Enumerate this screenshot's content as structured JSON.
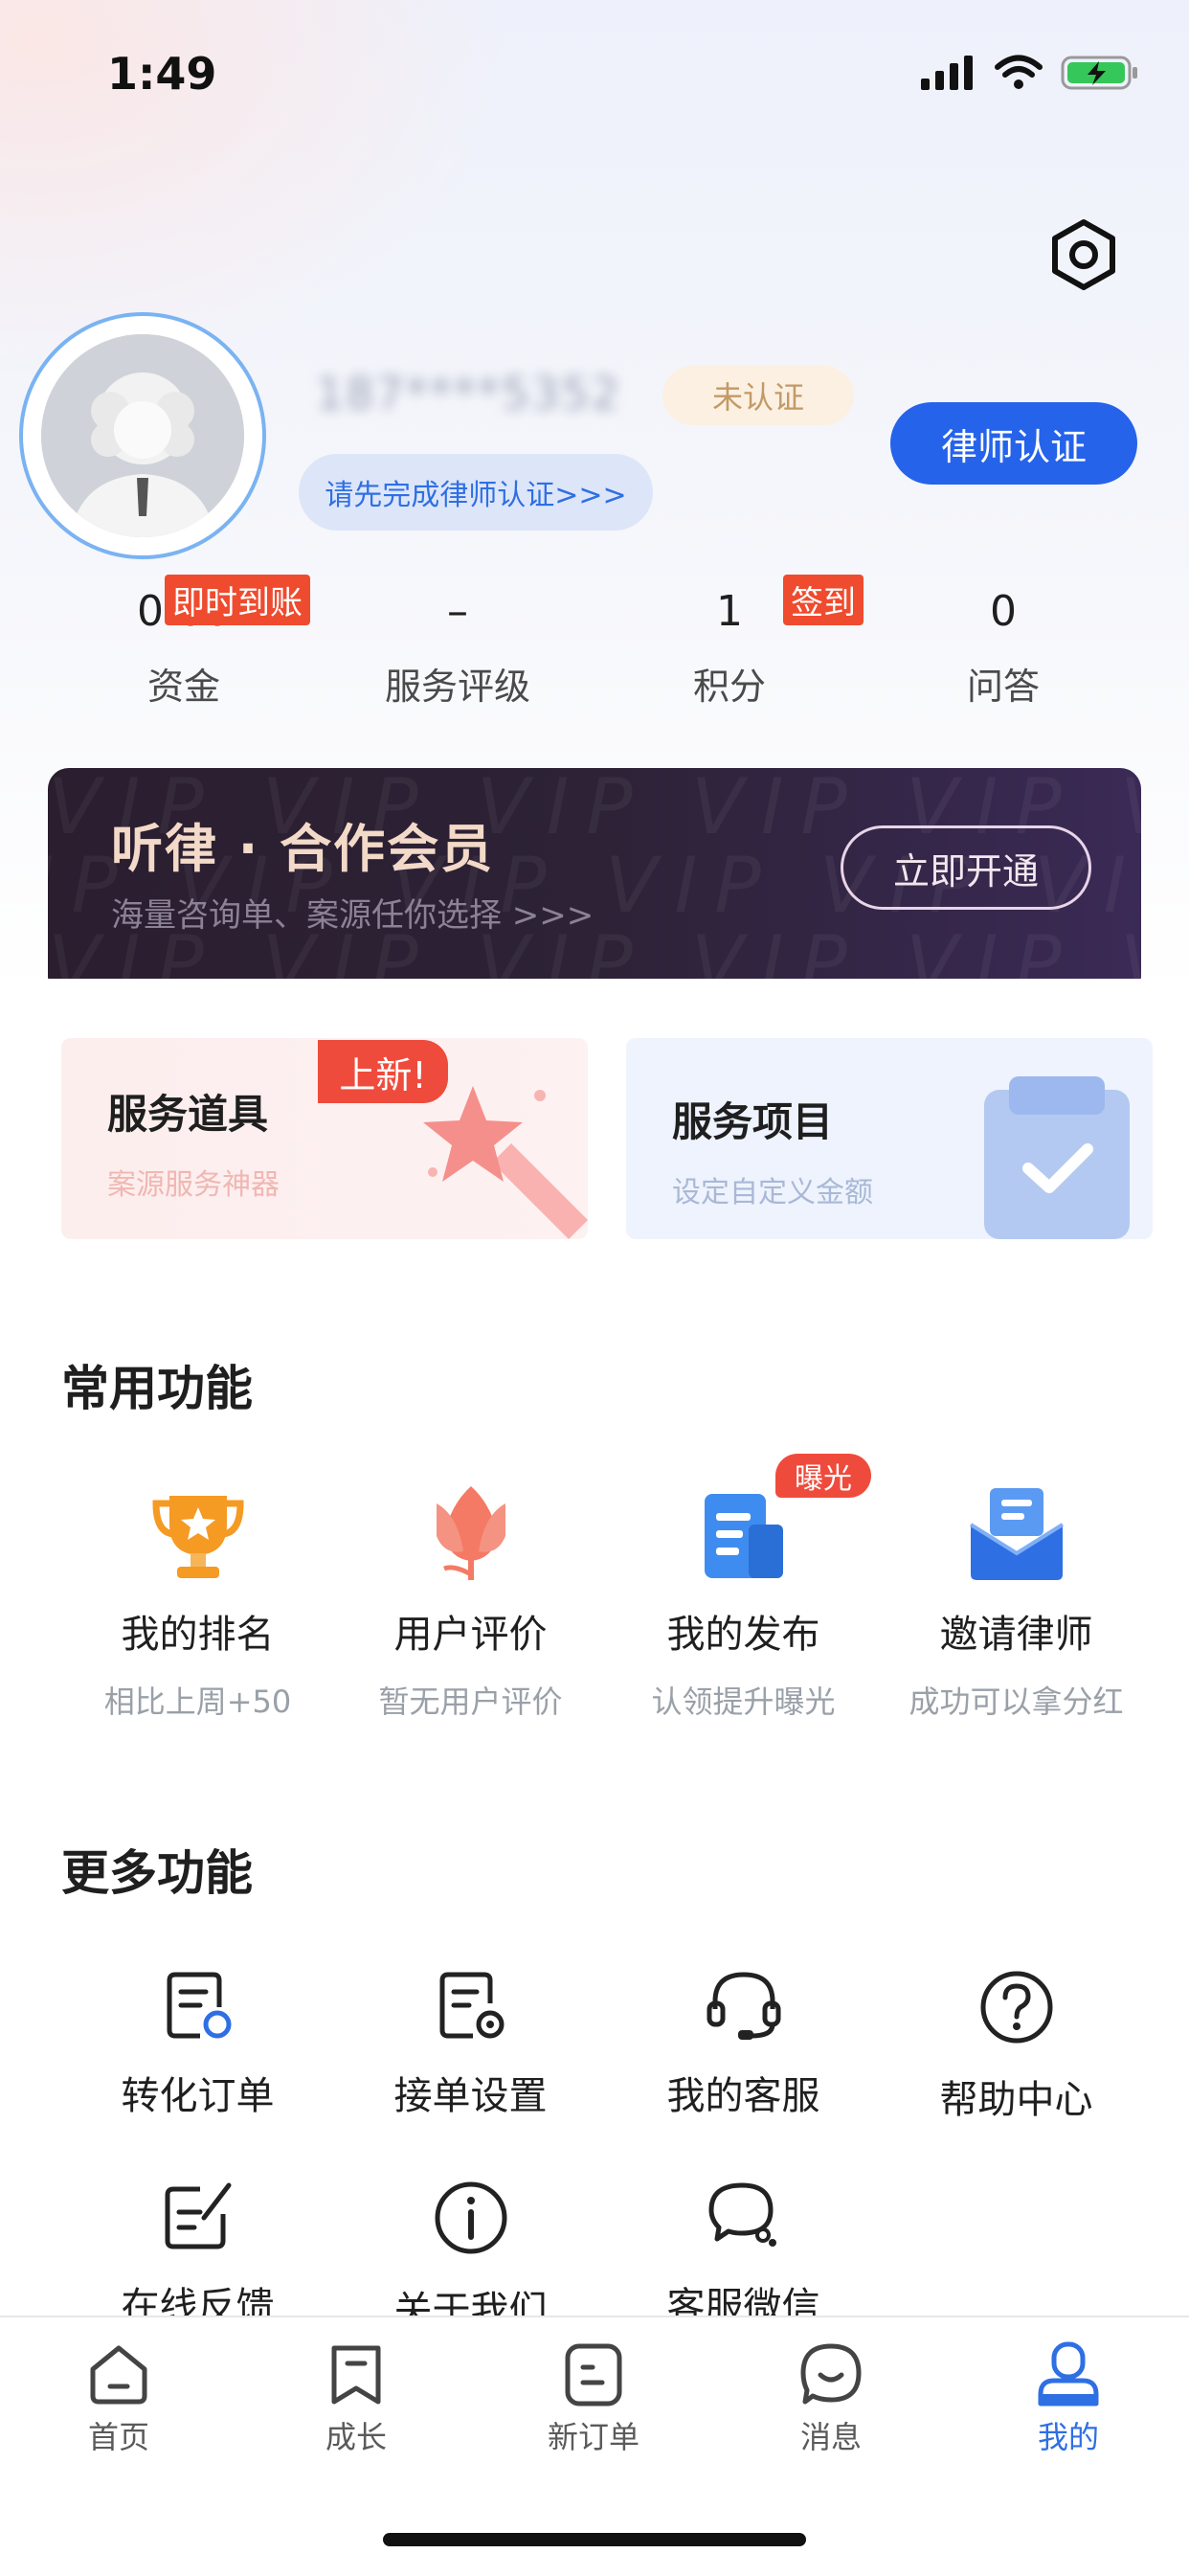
{
  "status_bar": {
    "time": "1:49"
  },
  "profile": {
    "name": "187****5352",
    "verify_badge": "未认证",
    "hint": "请先完成律师认证>>>",
    "cert_button": "律师认证"
  },
  "stats": [
    {
      "value": "0.00",
      "label": "资金",
      "tag": "即时到账"
    },
    {
      "value": "–",
      "label": "服务评级"
    },
    {
      "value": "1",
      "label": "积分",
      "tag": "签到"
    },
    {
      "value": "0",
      "label": "问答"
    }
  ],
  "vip": {
    "title": "听律 · 合作会员",
    "subtitle": "海量咨询单、案源任你选择 >>>",
    "button": "立即开通",
    "watermark": "VIP"
  },
  "cards": [
    {
      "title": "服务道具",
      "subtitle": "案源服务神器",
      "tag": "上新!"
    },
    {
      "title": "服务项目",
      "subtitle": "设定自定义金额"
    }
  ],
  "common": {
    "title": "常用功能",
    "items": [
      {
        "name": "我的排名",
        "sub": "相比上周+50",
        "icon": "trophy-icon"
      },
      {
        "name": "用户评价",
        "sub": "暂无用户评价",
        "icon": "tulip-icon"
      },
      {
        "name": "我的发布",
        "sub": "认领提升曝光",
        "icon": "document-icon",
        "tag": "曝光"
      },
      {
        "name": "邀请律师",
        "sub": "成功可以拿分红",
        "icon": "envelope-icon"
      }
    ]
  },
  "more": {
    "title": "更多功能",
    "items": [
      {
        "name": "转化订单",
        "icon": "convert-order-icon"
      },
      {
        "name": "接单设置",
        "icon": "order-settings-icon"
      },
      {
        "name": "我的客服",
        "icon": "headset-icon"
      },
      {
        "name": "帮助中心",
        "icon": "help-icon"
      },
      {
        "name": "在线反馈",
        "icon": "feedback-icon"
      },
      {
        "name": "关于我们",
        "icon": "info-icon"
      },
      {
        "name": "客服微信",
        "icon": "wechat-icon"
      }
    ]
  },
  "tabs": [
    {
      "label": "首页",
      "icon": "home-icon"
    },
    {
      "label": "成长",
      "icon": "bookmark-icon"
    },
    {
      "label": "新订单",
      "icon": "new-order-icon"
    },
    {
      "label": "消息",
      "icon": "message-icon"
    },
    {
      "label": "我的",
      "icon": "profile-icon",
      "active": true
    }
  ],
  "colors": {
    "primary": "#2563eb",
    "tag_red": "#ef4b3c",
    "active_tab": "#2f6fe4"
  }
}
